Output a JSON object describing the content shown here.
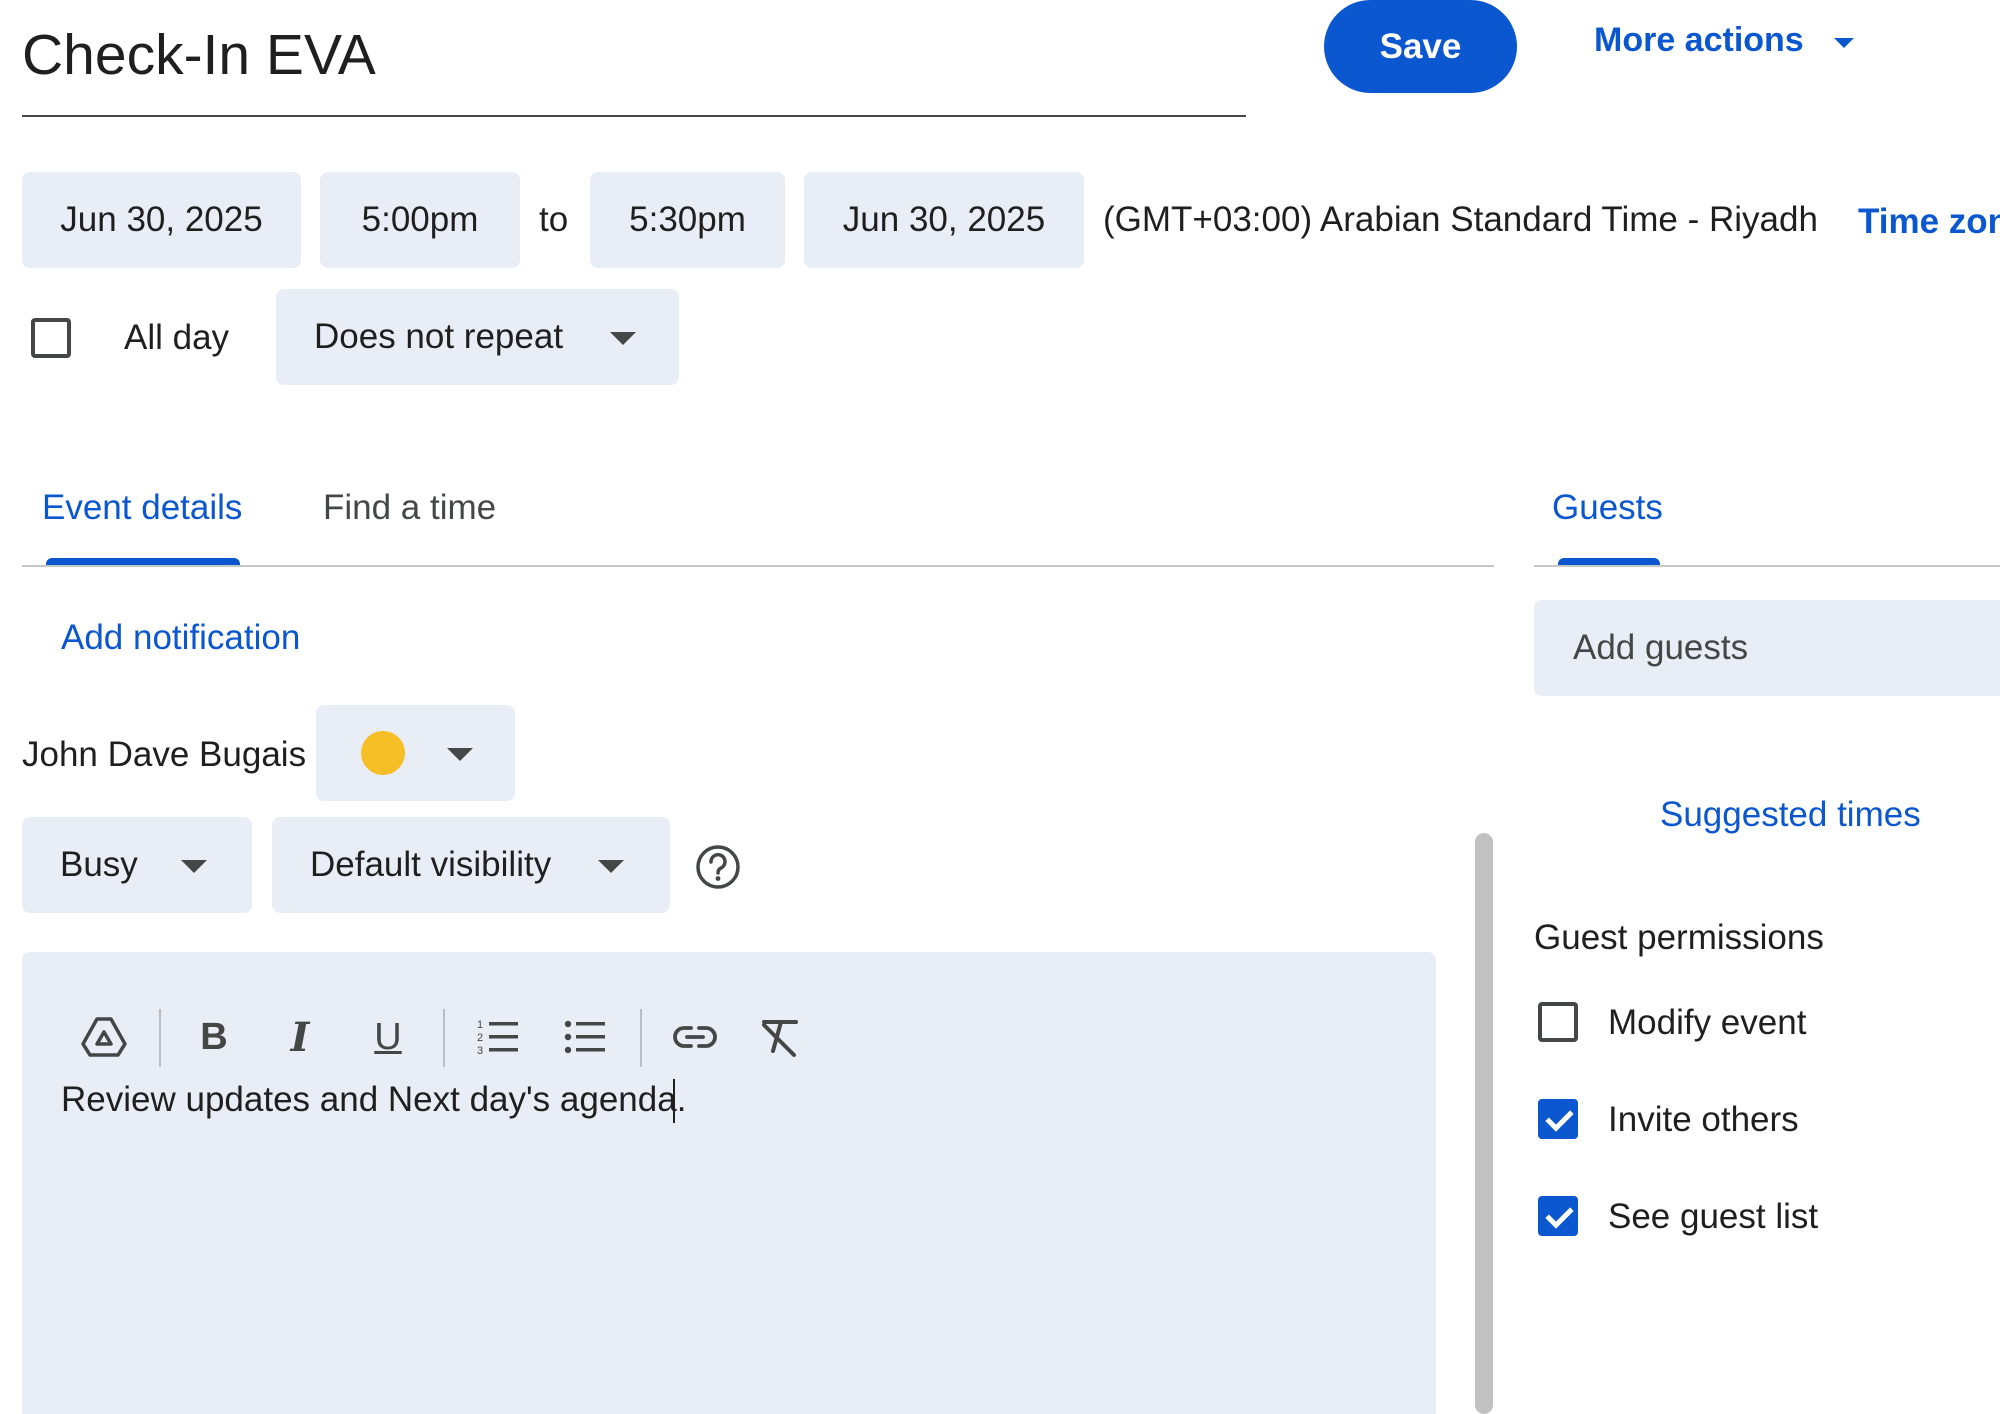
{
  "header": {
    "title": "Check-In EVA",
    "save_label": "Save",
    "more_actions_label": "More actions"
  },
  "datetime": {
    "start_date": "Jun 30, 2025",
    "start_time": "5:00pm",
    "to_label": "to",
    "end_time": "5:30pm",
    "end_date": "Jun 30, 2025",
    "timezone_text": "(GMT+03:00) Arabian Standard Time - Riyadh",
    "timezone_link": "Time zon"
  },
  "options": {
    "all_day_label": "All day",
    "all_day_checked": false,
    "repeat_value": "Does not repeat"
  },
  "tabs": [
    {
      "label": "Event details",
      "active": true
    },
    {
      "label": "Find a time",
      "active": false
    }
  ],
  "guests_tab": {
    "label": "Guests",
    "active": true
  },
  "details": {
    "add_notification_label": "Add notification",
    "calendar_owner": "John Dave Bugais",
    "calendar_color": "#f6bf26",
    "availability_value": "Busy",
    "visibility_value": "Default visibility",
    "description": "Review updates and Next day's agenda."
  },
  "toolbar_icons": [
    "drive-icon",
    "bold-icon",
    "italic-icon",
    "underline-icon",
    "numbered-list-icon",
    "bulleted-list-icon",
    "link-icon",
    "clear-formatting-icon"
  ],
  "guests": {
    "add_guests_placeholder": "Add guests",
    "suggested_times_label": "Suggested times",
    "permissions_title": "Guest permissions",
    "permissions": [
      {
        "label": "Modify event",
        "checked": false
      },
      {
        "label": "Invite others",
        "checked": true
      },
      {
        "label": "See guest list",
        "checked": true
      }
    ]
  },
  "colors": {
    "accent": "#0b57d0",
    "chip_bg": "#e9edf6"
  }
}
